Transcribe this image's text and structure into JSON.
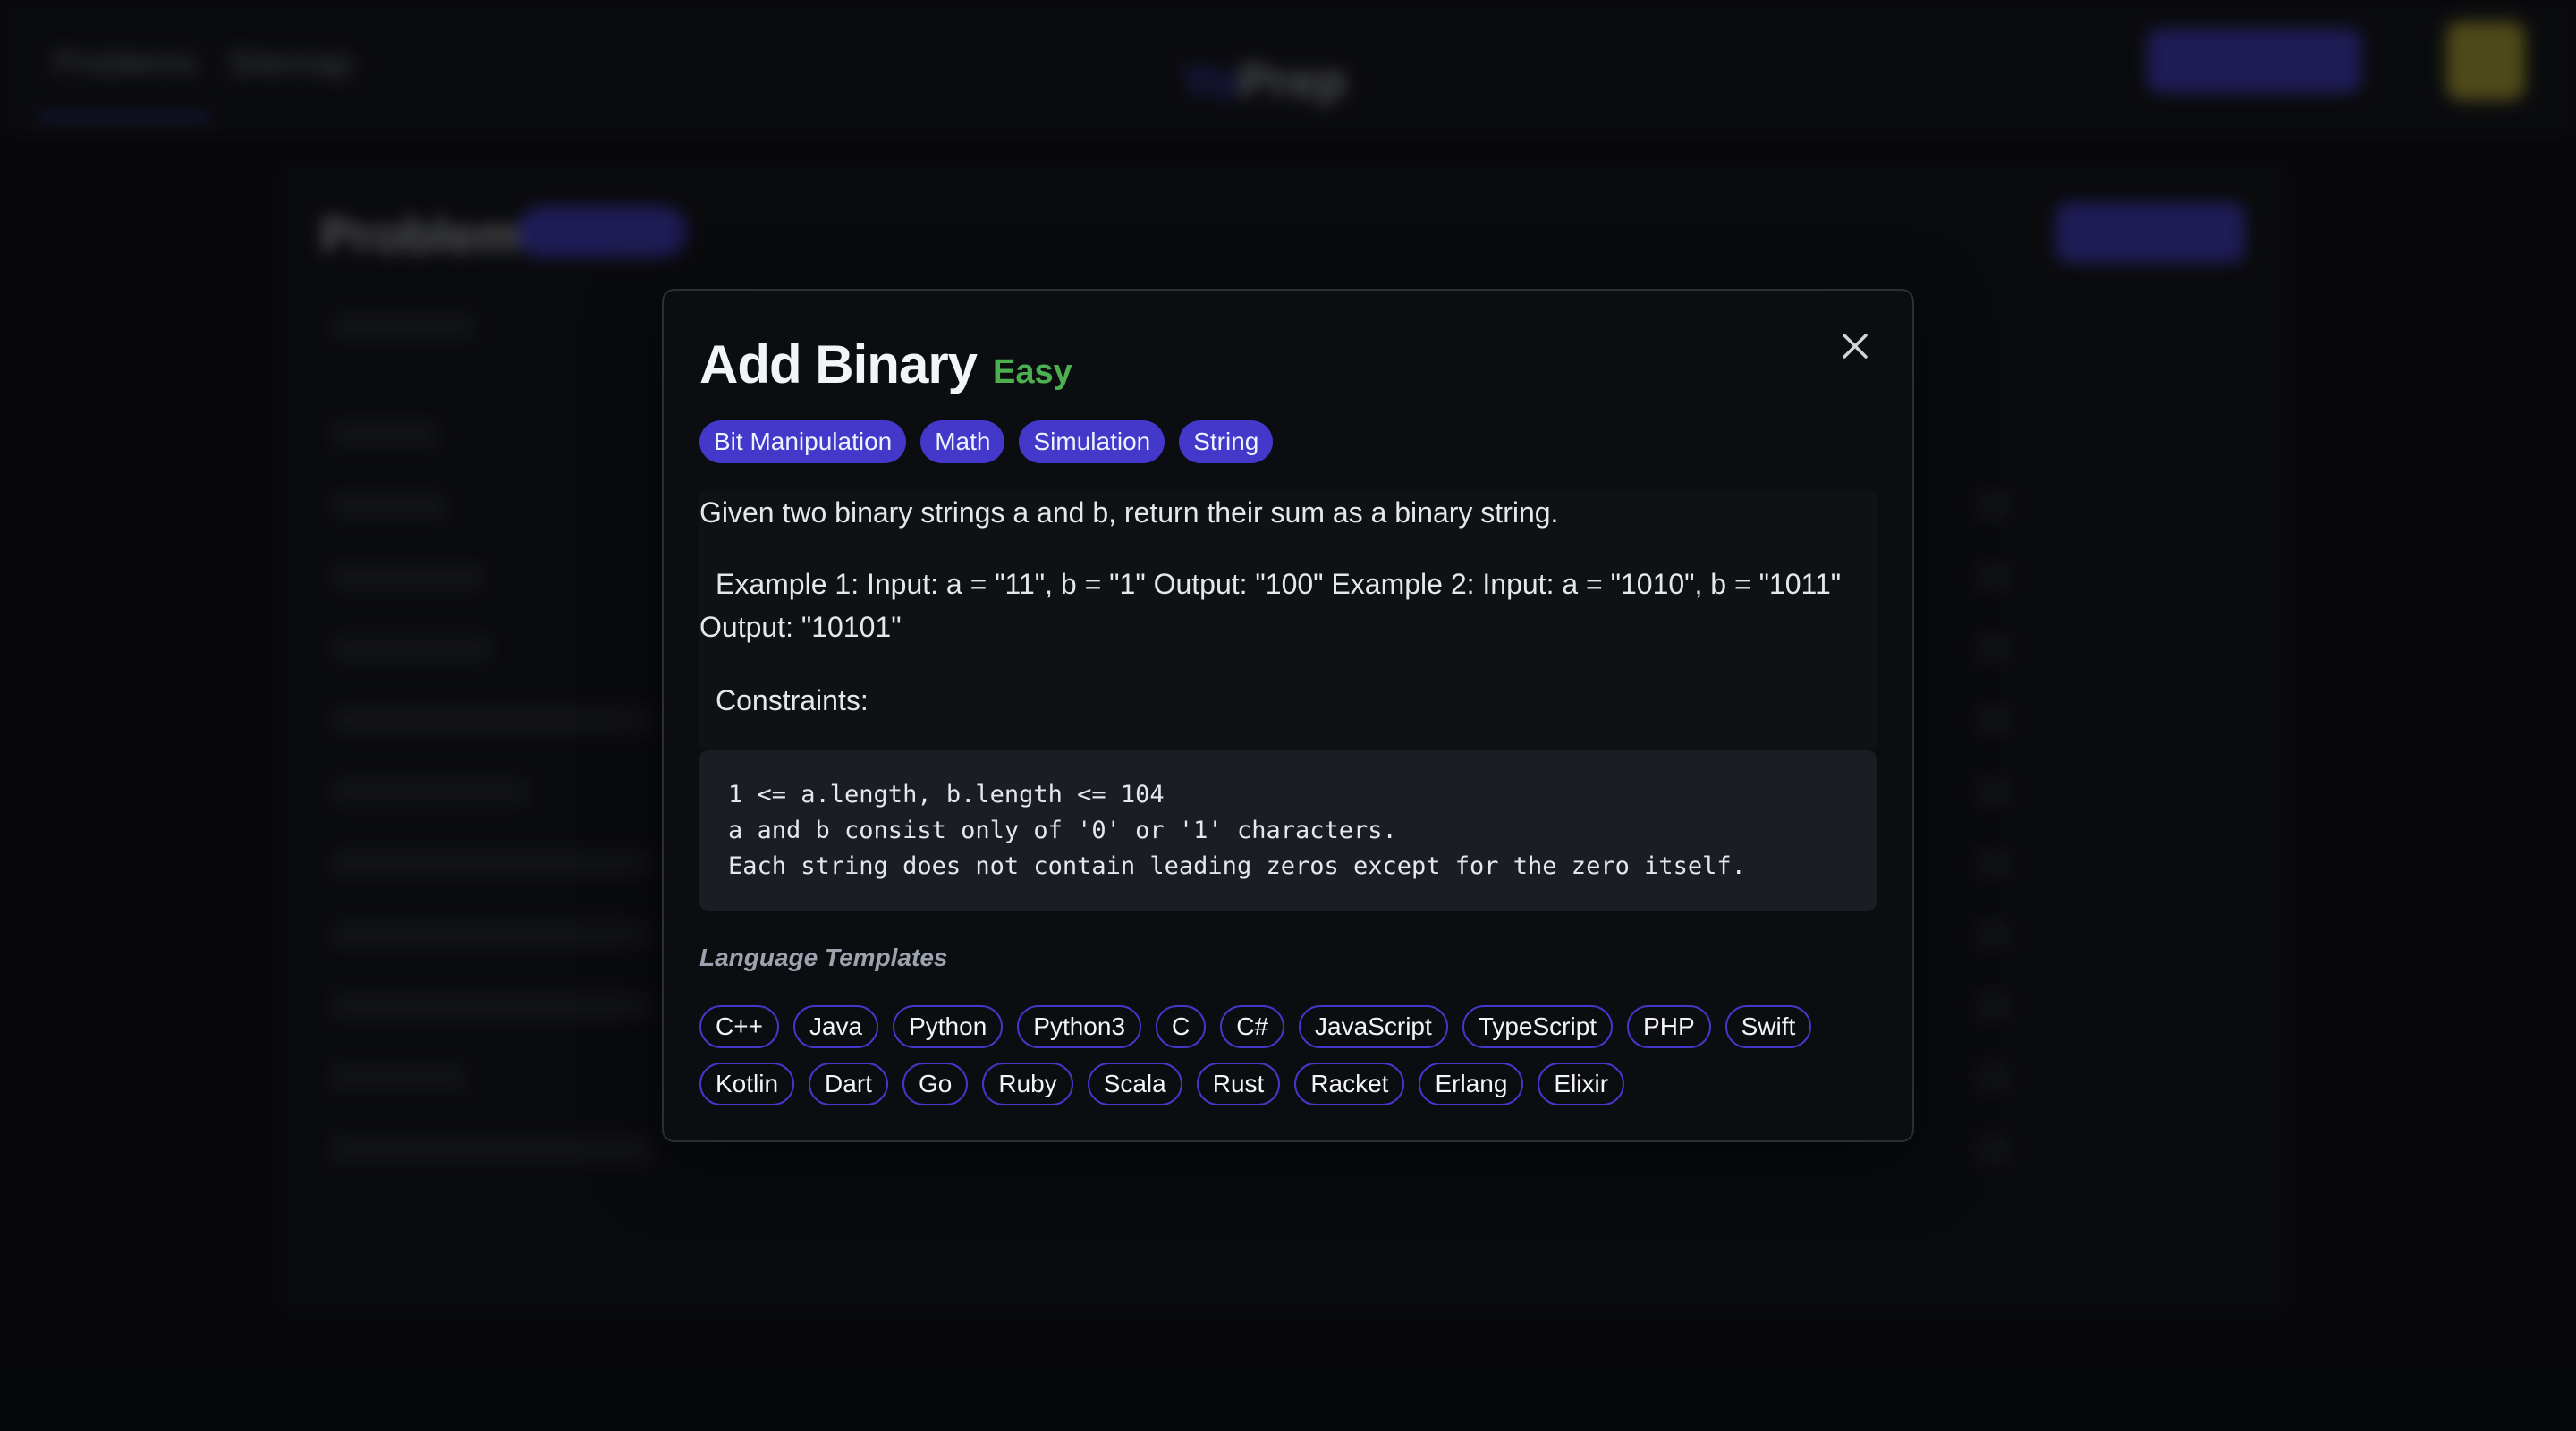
{
  "background": {
    "nav": {
      "links": [
        "Problems",
        "Sitemap"
      ],
      "logo_prefix": "Yo",
      "logo_suffix": "Prep"
    },
    "panel": {
      "title": "Problems"
    }
  },
  "modal": {
    "title": "Add Binary",
    "difficulty": "Easy",
    "difficulty_color": "#4caf50",
    "tags": [
      "Bit Manipulation",
      "Math",
      "Simulation",
      "String"
    ],
    "description": {
      "intro": "Given two binary strings a and b, return their sum as a binary string.",
      "examples": "Example 1: Input: a = \"11\", b = \"1\" Output: \"100\" Example 2: Input: a = \"1010\", b = \"1011\" Output: \"10101\"",
      "constraints_label": "Constraints:"
    },
    "constraints": [
      "1 <= a.length, b.length <= 104",
      "a and b consist only of '0' or '1' characters.",
      "Each string does not contain leading zeros except for the zero itself."
    ],
    "language_heading": "Language Templates",
    "languages_row1": [
      "C++",
      "Java",
      "Python",
      "Python3",
      "C",
      "C#",
      "JavaScript",
      "TypeScript",
      "PHP",
      "Swift"
    ],
    "languages_row2": [
      "Kotlin",
      "Dart",
      "Go",
      "Ruby",
      "Scala",
      "Rust",
      "Racket",
      "Erlang",
      "Elixir"
    ],
    "close_icon": "close-icon",
    "accent_color": "#4338ca"
  }
}
